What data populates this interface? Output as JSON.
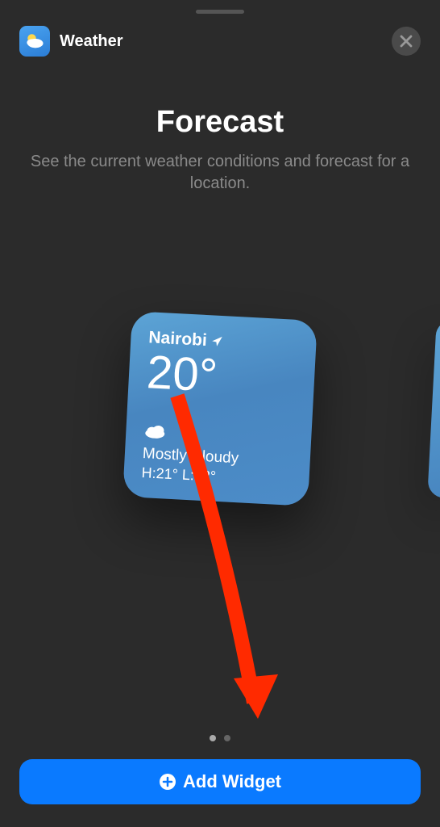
{
  "header": {
    "app_name": "Weather"
  },
  "title_section": {
    "title": "Forecast",
    "subtitle": "See the current weather conditions and forecast for a location."
  },
  "widget": {
    "location": "Nairobi",
    "temperature": "20°",
    "condition": "Mostly Cloudy",
    "high_low": "H:21° L:12°"
  },
  "pagination": {
    "count": 2,
    "current": 0
  },
  "button": {
    "label": "Add Widget"
  }
}
